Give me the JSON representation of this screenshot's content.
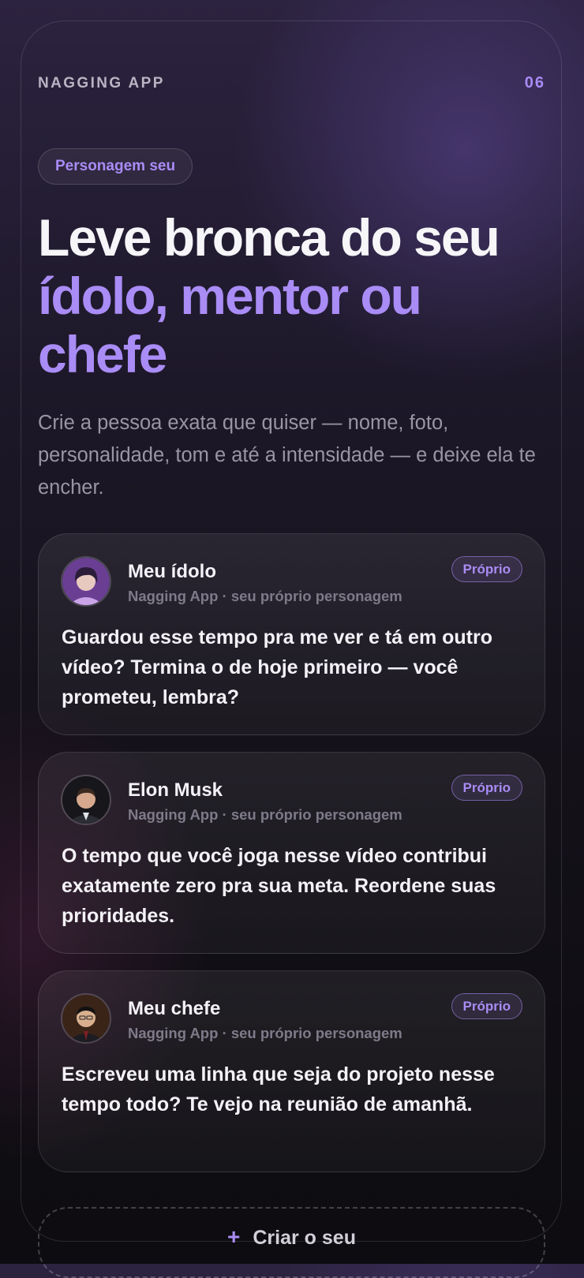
{
  "header": {
    "app_name": "NAGGING APP",
    "page_number": "06"
  },
  "hero": {
    "pill_label": "Personagem seu",
    "headline_line1": "Leve bronca do seu",
    "headline_accent_line1": "ídolo, mentor ou",
    "headline_accent_line2": "chefe",
    "subtitle": "Crie a pessoa exata que quiser — nome, foto, personalidade, tom e até a intensidade — e deixe ela te encher."
  },
  "cards": [
    {
      "name": "Meu ídolo",
      "meta": "Nagging App · seu próprio personagem",
      "badge": "Próprio",
      "message": "Guardou esse tempo pra me ver e tá em outro vídeo? Termina o de hoje primeiro — você prometeu, lembra?",
      "avatar_icon": "idol-avatar-icon"
    },
    {
      "name": "Elon Musk",
      "meta": "Nagging App · seu próprio personagem",
      "badge": "Próprio",
      "message": "O tempo que você joga nesse vídeo contribui exatamente zero pra sua meta. Reordene suas prioridades.",
      "avatar_icon": "elon-musk-avatar-icon"
    },
    {
      "name": "Meu chefe",
      "meta": "Nagging App · seu próprio personagem",
      "badge": "Próprio",
      "message": "Escreveu uma linha que seja do projeto nesse tempo todo? Te vejo na reunião de amanhã.",
      "avatar_icon": "boss-avatar-icon"
    }
  ],
  "create_button": {
    "icon": "plus-icon",
    "label": "Criar o seu"
  },
  "colors": {
    "accent": "#a98cf5",
    "background_top": "#2c2340",
    "background_bottom": "#0d0c10",
    "text_primary": "#f4f2f7",
    "text_secondary": "#9a95a4"
  }
}
